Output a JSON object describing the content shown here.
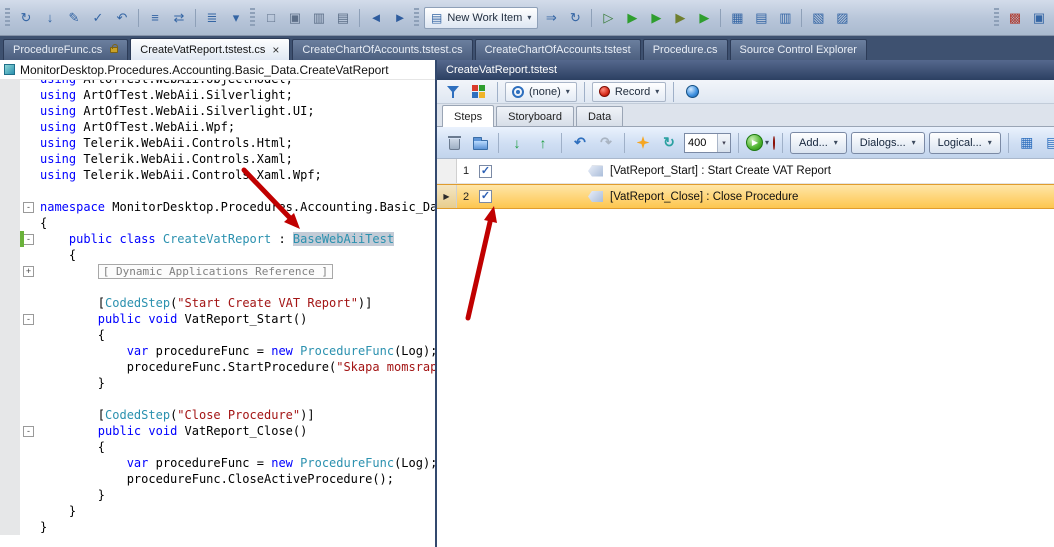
{
  "colors": {
    "selection_orange": "#fdc64f",
    "tab_strip_blue": "#3e5170",
    "pane_title_blue": "#2c4062",
    "keyword_blue": "#0000ff",
    "type_teal": "#2b91af",
    "string_red": "#a31515",
    "annotation_arrow_red": "#c00000",
    "changed_line_green": "#6ab23a"
  },
  "top_toolbar": {
    "new_work_item_label": "New Work Item",
    "items": [
      {
        "t": "grip"
      },
      {
        "t": "icon",
        "name": "refresh-source-icon",
        "g": "↻",
        "c": "#3465a4"
      },
      {
        "t": "icon",
        "name": "get-latest-icon",
        "g": "↓",
        "c": "#3465a4"
      },
      {
        "t": "icon",
        "name": "check-out-icon",
        "g": "✎",
        "c": "#3465a4"
      },
      {
        "t": "icon",
        "name": "check-in-icon",
        "g": "✓",
        "c": "#3465a4"
      },
      {
        "t": "icon",
        "name": "undo-pending-icon",
        "g": "↶",
        "c": "#3465a4"
      },
      {
        "t": "sep"
      },
      {
        "t": "icon",
        "name": "view-history-icon",
        "g": "≡",
        "c": "#3465a4"
      },
      {
        "t": "icon",
        "name": "compare-icon",
        "g": "⇄",
        "c": "#3465a4"
      },
      {
        "t": "sep"
      },
      {
        "t": "icon",
        "name": "outline-collapse-icon",
        "g": "≣",
        "c": "#3465a4"
      },
      {
        "t": "icon",
        "name": "bookmark-icon",
        "g": "▾",
        "c": "#3465a4"
      },
      {
        "t": "grip"
      },
      {
        "t": "icon",
        "name": "window-code-icon",
        "g": "□",
        "c": "#5d6f88"
      },
      {
        "t": "icon",
        "name": "window-designer-icon",
        "g": "▣",
        "c": "#5d6f88"
      },
      {
        "t": "icon",
        "name": "window-split-icon",
        "g": "▥",
        "c": "#5d6f88"
      },
      {
        "t": "icon",
        "name": "window-dock-icon",
        "g": "▤",
        "c": "#5d6f88"
      },
      {
        "t": "sep"
      },
      {
        "t": "icon",
        "name": "navigate-back-icon",
        "g": "◄",
        "c": "#2e5c9e"
      },
      {
        "t": "icon",
        "name": "navigate-forward-icon",
        "g": "►",
        "c": "#2e5c9e"
      },
      {
        "t": "grip"
      },
      {
        "t": "newitem"
      },
      {
        "t": "icon",
        "name": "link-work-item-icon",
        "g": "⇒",
        "c": "#3465a4"
      },
      {
        "t": "icon",
        "name": "refresh-query-icon",
        "g": "↻",
        "c": "#3465a4"
      },
      {
        "t": "sep"
      },
      {
        "t": "icon",
        "name": "open-test-icon",
        "g": "▷",
        "c": "#3a7d3a"
      },
      {
        "t": "icon",
        "name": "run-tests-icon",
        "g": "▶",
        "c": "#2f9e2f"
      },
      {
        "t": "icon",
        "name": "run-all-tests-icon",
        "g": "▶",
        "c": "#2f9e2f"
      },
      {
        "t": "icon",
        "name": "debug-tests-icon",
        "g": "▶",
        "c": "#6f7f2f"
      },
      {
        "t": "icon",
        "name": "run-with-options-icon",
        "g": "▶",
        "c": "#2f9e2f"
      },
      {
        "t": "sep"
      },
      {
        "t": "icon",
        "name": "test-view-icon",
        "g": "▦",
        "c": "#3465a4"
      },
      {
        "t": "icon",
        "name": "test-results-icon",
        "g": "▤",
        "c": "#3465a4"
      },
      {
        "t": "icon",
        "name": "test-list-editor-icon",
        "g": "▥",
        "c": "#3465a4"
      },
      {
        "t": "sep"
      },
      {
        "t": "icon",
        "name": "error-list-icon",
        "g": "▧",
        "c": "#3465a4"
      },
      {
        "t": "icon",
        "name": "output-window-icon",
        "g": "▨",
        "c": "#3465a4"
      },
      {
        "t": "flex"
      },
      {
        "t": "grip"
      },
      {
        "t": "icon",
        "name": "extension-icon",
        "g": "▩",
        "c": "#b03a2e"
      },
      {
        "t": "icon",
        "name": "help-icon",
        "g": "▣",
        "c": "#3465a4"
      }
    ]
  },
  "tab_strip": {
    "tabs": [
      {
        "label": "ProcedureFunc.cs",
        "icon": "lock"
      },
      {
        "label": "CreateVatReport.tstest.cs",
        "active": true,
        "close": true
      },
      {
        "label": "CreateChartOfAccounts.tstest.cs"
      },
      {
        "label": "CreateChartOfAccounts.tstest"
      },
      {
        "label": "Procedure.cs"
      },
      {
        "label": "Source Control Explorer"
      }
    ]
  },
  "editor": {
    "breadcrumb": "MonitorDesktop.Procedures.Accounting.Basic_Data.CreateVatReport",
    "lines": [
      {
        "clip": true,
        "seg": [
          [
            "k",
            "using"
          ],
          [
            "p",
            " ArtOfTest.WebAii.ObjectModel;"
          ]
        ]
      },
      {
        "seg": [
          [
            "k",
            "using"
          ],
          [
            "p",
            " ArtOfTest.WebAii.Silverlight;"
          ]
        ]
      },
      {
        "seg": [
          [
            "k",
            "using"
          ],
          [
            "p",
            " ArtOfTest.WebAii.Silverlight.UI;"
          ]
        ]
      },
      {
        "seg": [
          [
            "k",
            "using"
          ],
          [
            "p",
            " ArtOfTest.WebAii.Wpf;"
          ]
        ]
      },
      {
        "seg": [
          [
            "k",
            "using"
          ],
          [
            "p",
            " Telerik.WebAii.Controls.Html;"
          ]
        ]
      },
      {
        "seg": [
          [
            "k",
            "using"
          ],
          [
            "p",
            " Telerik.WebAii.Controls.Xaml;"
          ]
        ]
      },
      {
        "seg": [
          [
            "k",
            "using"
          ],
          [
            "p",
            " Telerik.WebAii.Controls.Xaml.Wpf;"
          ]
        ]
      },
      {
        "seg": []
      },
      {
        "fold": "minus",
        "seg": [
          [
            "k",
            "namespace"
          ],
          [
            "p",
            " MonitorDesktop.Procedures.Accounting.Basic_Data"
          ]
        ]
      },
      {
        "seg": [
          [
            "p",
            "{"
          ]
        ]
      },
      {
        "fold": "minus",
        "bar": true,
        "seg": [
          [
            "p",
            "    "
          ],
          [
            "k",
            "public"
          ],
          [
            "p",
            " "
          ],
          [
            "k",
            "class"
          ],
          [
            "p",
            " "
          ],
          [
            "t",
            "CreateVatReport"
          ],
          [
            "p",
            " : "
          ],
          [
            "hl",
            "BaseWebAiiTest"
          ]
        ]
      },
      {
        "seg": [
          [
            "p",
            "    {"
          ]
        ]
      },
      {
        "fold": "plus",
        "seg": [
          [
            "p",
            "        "
          ],
          [
            "box",
            "[ Dynamic Applications Reference ]"
          ]
        ]
      },
      {
        "seg": []
      },
      {
        "seg": [
          [
            "p",
            "        ["
          ],
          [
            "t",
            "CodedStep"
          ],
          [
            "p",
            "("
          ],
          [
            "s",
            "\"Start Create VAT Report\""
          ],
          [
            "p",
            ")]"
          ]
        ]
      },
      {
        "fold": "minus",
        "seg": [
          [
            "p",
            "        "
          ],
          [
            "k",
            "public"
          ],
          [
            "p",
            " "
          ],
          [
            "k",
            "void"
          ],
          [
            "p",
            " VatReport_Start()"
          ]
        ]
      },
      {
        "seg": [
          [
            "p",
            "        {"
          ]
        ]
      },
      {
        "seg": [
          [
            "p",
            "            "
          ],
          [
            "k",
            "var"
          ],
          [
            "p",
            " procedureFunc = "
          ],
          [
            "k",
            "new"
          ],
          [
            "p",
            " "
          ],
          [
            "t",
            "ProcedureFunc"
          ],
          [
            "p",
            "(Log);"
          ]
        ]
      },
      {
        "seg": [
          [
            "p",
            "            procedureFunc.StartProcedure("
          ],
          [
            "s",
            "\"Skapa momsrappo"
          ]
        ]
      },
      {
        "seg": [
          [
            "p",
            "        }"
          ]
        ]
      },
      {
        "seg": []
      },
      {
        "seg": [
          [
            "p",
            "        ["
          ],
          [
            "t",
            "CodedStep"
          ],
          [
            "p",
            "("
          ],
          [
            "s",
            "\"Close Procedure\""
          ],
          [
            "p",
            ")]"
          ]
        ]
      },
      {
        "fold": "minus",
        "seg": [
          [
            "p",
            "        "
          ],
          [
            "k",
            "public"
          ],
          [
            "p",
            " "
          ],
          [
            "k",
            "void"
          ],
          [
            "p",
            " VatReport_Close()"
          ]
        ]
      },
      {
        "seg": [
          [
            "p",
            "        {"
          ]
        ]
      },
      {
        "seg": [
          [
            "p",
            "            "
          ],
          [
            "k",
            "var"
          ],
          [
            "p",
            " procedureFunc = "
          ],
          [
            "k",
            "new"
          ],
          [
            "p",
            " "
          ],
          [
            "t",
            "ProcedureFunc"
          ],
          [
            "p",
            "(Log);"
          ]
        ]
      },
      {
        "seg": [
          [
            "p",
            "            procedureFunc.CloseActiveProcedure();"
          ]
        ]
      },
      {
        "seg": [
          [
            "p",
            "        }"
          ]
        ]
      },
      {
        "seg": [
          [
            "p",
            "    }"
          ]
        ]
      },
      {
        "seg": [
          [
            "p",
            "}"
          ]
        ]
      }
    ]
  },
  "test_pane": {
    "title": "CreateVatReport.tstest",
    "toolbar1": [
      {
        "type": "icon",
        "name": "filter-edit-icon",
        "css": "funnel"
      },
      {
        "type": "icon",
        "name": "highlight-element-icon",
        "css": "palette"
      },
      {
        "type": "sep"
      },
      {
        "type": "dropdown",
        "name": "data-source-dropdown",
        "css": "target",
        "label": "(none)"
      },
      {
        "type": "sep"
      },
      {
        "type": "dropdown",
        "name": "record-dropdown",
        "css": "dot-red",
        "label": "Record"
      },
      {
        "type": "sep"
      },
      {
        "type": "icon",
        "name": "browser-globe-icon",
        "css": "globe"
      }
    ],
    "tabs": [
      "Steps",
      "Storyboard",
      "Data"
    ],
    "active_tab": 0,
    "toolbar2": [
      {
        "type": "icon",
        "name": "delete-step-icon",
        "css": "trash"
      },
      {
        "type": "icon",
        "name": "copy-steps-icon",
        "css": "folder"
      },
      {
        "type": "sep"
      },
      {
        "type": "icon",
        "name": "move-step-down-icon",
        "glyph": "↓",
        "color": "#1f9e42",
        "bold": 1
      },
      {
        "type": "icon",
        "name": "move-step-up-icon",
        "glyph": "↑",
        "color": "#1f9e42",
        "bold": 1
      },
      {
        "type": "sep"
      },
      {
        "type": "icon",
        "name": "undo-icon",
        "glyph": "↶",
        "color": "#2e6fbe",
        "bold": 1
      },
      {
        "type": "icon",
        "name": "redo-icon",
        "glyph": "↷",
        "color": "#a9b4c2",
        "bold": 1
      },
      {
        "type": "sep"
      },
      {
        "type": "icon",
        "name": "highlight-sparkle-icon",
        "css": "sparkle"
      },
      {
        "type": "icon",
        "name": "refresh-delay-icon",
        "glyph": "↻",
        "color": "#2aa1a1",
        "bold": 1
      },
      {
        "type": "delay",
        "name": "execution-delay-input",
        "value": "400"
      },
      {
        "type": "sep"
      },
      {
        "type": "run",
        "name": "run-button"
      },
      {
        "type": "record",
        "name": "record-step-button"
      },
      {
        "type": "sep"
      },
      {
        "type": "dropbtn",
        "name": "add-dropdown",
        "label": "Add..."
      },
      {
        "type": "dropbtn",
        "name": "dialogs-dropdown",
        "label": "Dialogs..."
      },
      {
        "type": "dropbtn",
        "name": "logical-dropdown",
        "label": "Logical..."
      },
      {
        "type": "sep"
      },
      {
        "type": "icon",
        "name": "test-lists-icon",
        "glyph": "▦",
        "color": "#2e6fbe"
      },
      {
        "type": "icon",
        "name": "element-explorer-icon",
        "glyph": "▤",
        "color": "#2e6fbe"
      }
    ],
    "steps": [
      {
        "num": "1",
        "checked": true,
        "selected": false,
        "label": "[VatReport_Start] : Start Create VAT Report"
      },
      {
        "num": "2",
        "checked": true,
        "selected": true,
        "label": "[VatReport_Close] : Close Procedure"
      }
    ]
  }
}
